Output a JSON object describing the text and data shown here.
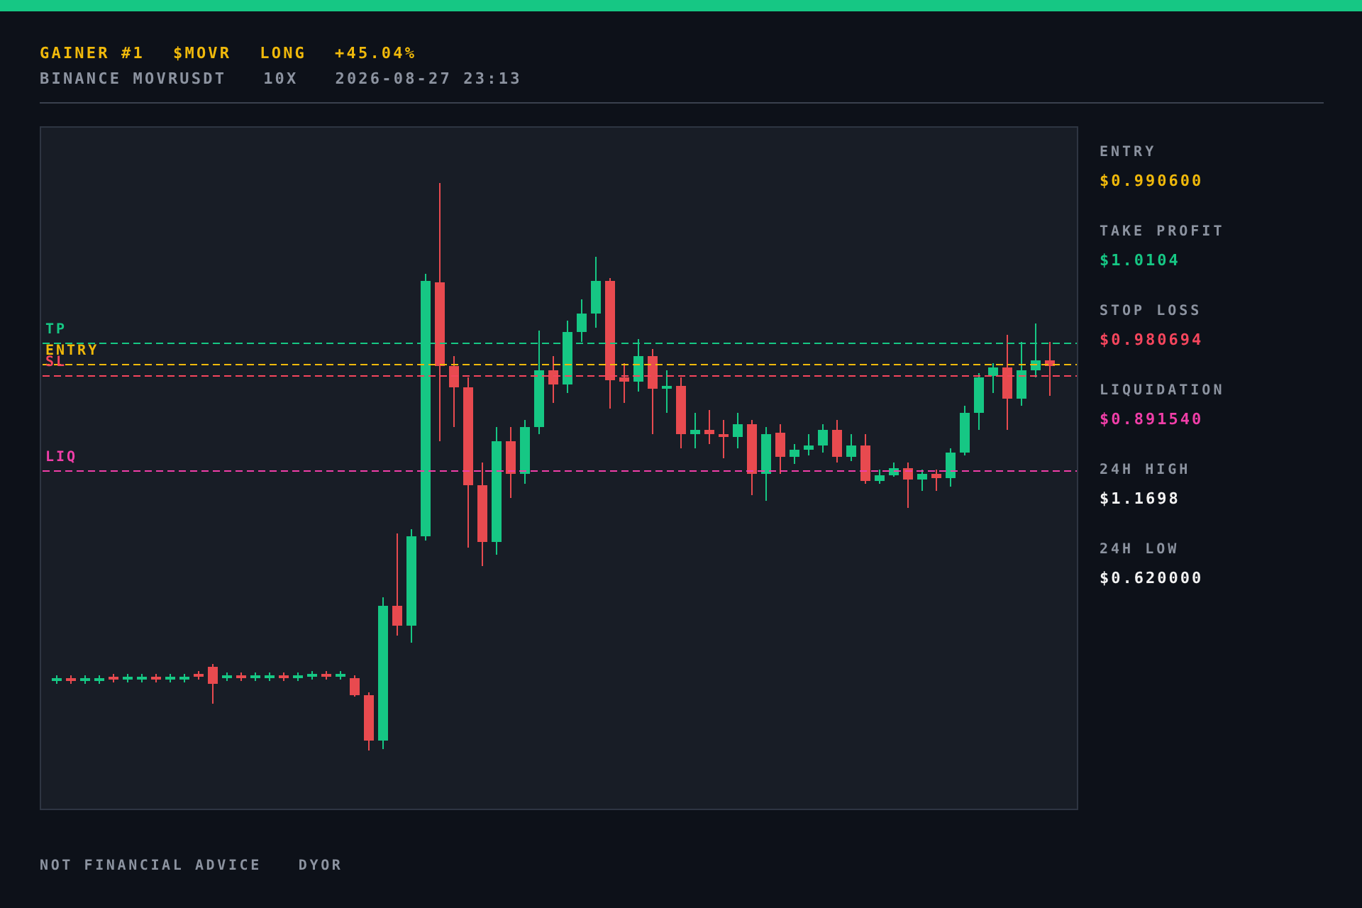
{
  "header": {
    "headline": [
      "GAINER #1",
      "$MOVR",
      "LONG",
      "+45.04%"
    ],
    "subline": [
      "BINANCE MOVRUSDT",
      "10X",
      "2026-08-27 23:13"
    ]
  },
  "chart": {
    "levels": [
      {
        "label": "TP",
        "color": "#16c784"
      },
      {
        "label": "ENTRY",
        "color": "#f0b90b"
      },
      {
        "label": "SL",
        "color": "#f6465d"
      },
      {
        "label": "LIQ",
        "color": "#f03ea8"
      }
    ]
  },
  "stats": [
    {
      "label": "ENTRY",
      "value": "$0.990600",
      "color": "#f0b90b"
    },
    {
      "label": "TAKE PROFIT",
      "value": "$1.0104",
      "color": "#16c784"
    },
    {
      "label": "STOP LOSS",
      "value": "$0.980694",
      "color": "#f6465d"
    },
    {
      "label": "LIQUIDATION",
      "value": "$0.891540",
      "color": "#f03ea8"
    },
    {
      "label": "24H HIGH",
      "value": "$1.1698",
      "color": "#f2f2f2"
    },
    {
      "label": "24H LOW",
      "value": "$0.620000",
      "color": "#f2f2f2"
    }
  ],
  "footer": [
    "NOT FINANCIAL ADVICE",
    "DYOR"
  ]
}
